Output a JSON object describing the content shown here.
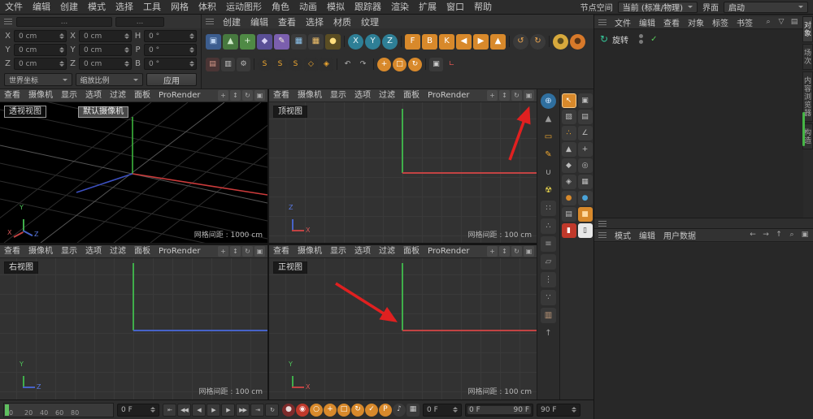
{
  "menubar": {
    "items": [
      "文件",
      "编辑",
      "创建",
      "模式",
      "选择",
      "工具",
      "网格",
      "体积",
      "运动图形",
      "角色",
      "动画",
      "模拟",
      "跟踪器",
      "渲染",
      "扩展",
      "窗口",
      "帮助"
    ],
    "node_space_label": "节点空间",
    "render_engine": "当前 (标准/物理)",
    "interface_label": "界面",
    "layout_value": "启动"
  },
  "coord_panel": {
    "tab1": "...",
    "tab2": "...",
    "rows": [
      {
        "a": "X",
        "av": "0 cm",
        "b": "X",
        "bv": "0 cm",
        "c": "H",
        "cv": "0 °"
      },
      {
        "a": "Y",
        "av": "0 cm",
        "b": "Y",
        "bv": "0 cm",
        "c": "P",
        "cv": "0 °"
      },
      {
        "a": "Z",
        "av": "0 cm",
        "b": "Z",
        "bv": "0 cm",
        "c": "B",
        "cv": "0 °"
      }
    ],
    "world_dropdown": "世界坐标",
    "scale_dropdown": "缩放比例",
    "apply_button": "应用"
  },
  "edit_menubar": [
    "创建",
    "编辑",
    "查看",
    "选择",
    "材质",
    "纹理"
  ],
  "toolbar_row1": [
    {
      "n": "primitive-cube-icon",
      "g": "▣",
      "c": "#bcd4f2",
      "b": "#3c5d8f"
    },
    {
      "n": "pyramid-icon",
      "g": "▲",
      "c": "#cfe9c8",
      "b": "#47793f"
    },
    {
      "n": "mograph-icon",
      "g": "+",
      "c": "#dff3da",
      "b": "#4f8a45"
    },
    {
      "n": "volume-icon",
      "g": "◆",
      "c": "#d9d2f5",
      "b": "#5a4f96"
    },
    {
      "n": "spline-pen-icon",
      "g": "✎",
      "c": "#f2ead8",
      "b": "#7b5fae"
    },
    {
      "n": "camera-icon",
      "g": "▦",
      "c": "#8ec6f0",
      "b": "#3a3a3a"
    },
    {
      "n": "render-settings-icon",
      "g": "▦",
      "c": "#f0c06a",
      "b": "#3a3a3a"
    },
    {
      "n": "light-icon",
      "g": "●",
      "c": "#ffdf7e",
      "b": "#5a4d23"
    },
    {
      "sep": 1
    },
    {
      "n": "lock-x-button",
      "g": "X",
      "c": "#eaf6f8",
      "b": "#2e7f96",
      "r": "50%"
    },
    {
      "n": "lock-y-button",
      "g": "Y",
      "c": "#eaf6f8",
      "b": "#2e7f96",
      "r": "50%"
    },
    {
      "n": "lock-z-button",
      "g": "Z",
      "c": "#eaf6f8",
      "b": "#2e7f96",
      "r": "50%"
    },
    {
      "sep": 1
    },
    {
      "n": "key-f-button",
      "g": "F",
      "c": "#ffffff",
      "b": "#d8892b"
    },
    {
      "n": "key-b-button",
      "g": "B",
      "c": "#ffffff",
      "b": "#d8892b"
    },
    {
      "n": "key-k-button",
      "g": "K",
      "c": "#ffffff",
      "b": "#d8892b"
    },
    {
      "n": "nav-left-button",
      "g": "◀",
      "c": "#ffffff",
      "b": "#d8892b"
    },
    {
      "n": "nav-right-button",
      "g": "▶",
      "c": "#ffffff",
      "b": "#d8892b"
    },
    {
      "n": "nav-up-button",
      "g": "▲",
      "c": "#ffffff",
      "b": "#d8892b"
    },
    {
      "sep": 1
    },
    {
      "n": "ik-circle-icon",
      "g": "↺",
      "c": "#f0a850",
      "b": "#3a3a3a",
      "r": "50%"
    },
    {
      "n": "dynamics-circle-icon",
      "g": "↻",
      "c": "#f0a850",
      "b": "#3a3a3a",
      "r": "50%"
    },
    {
      "sep": 1
    },
    {
      "n": "render-gold-icon",
      "g": "●",
      "c": "#5a4b1e",
      "b": "#d7a93c",
      "r": "50%"
    },
    {
      "n": "material-orange-icon",
      "g": "●",
      "c": "#5a3516",
      "b": "#d8792a",
      "r": "50%"
    }
  ],
  "toolbar_row2": [
    {
      "n": "paint-icon",
      "g": "▤",
      "c": "#d89a8a",
      "b": "#4a3535"
    },
    {
      "n": "uv-icon",
      "g": "▥",
      "c": "#c8c8c8",
      "b": "#3a3a3a"
    },
    {
      "n": "gear-icon",
      "g": "⚙",
      "c": "#bdbdbd",
      "b": "#3a3a3a"
    },
    {
      "sep": 1
    },
    {
      "n": "snap-1-icon",
      "g": "S",
      "c": "#f0a830",
      "b": "#2d2d2d",
      "r": "50%"
    },
    {
      "n": "snap-2-icon",
      "g": "S",
      "c": "#f0a830",
      "b": "#2d2d2d",
      "r": "50%"
    },
    {
      "n": "snap-3-icon",
      "g": "S",
      "c": "#f0a830",
      "b": "#2d2d2d",
      "r": "50%"
    },
    {
      "n": "quantize-icon",
      "g": "◇",
      "c": "#f0a830",
      "b": "#2d2d2d"
    },
    {
      "n": "workplane-icon",
      "g": "◈",
      "c": "#f0a830",
      "b": "#2d2d2d"
    },
    {
      "sep": 1
    },
    {
      "n": "undo-icon",
      "g": "↶",
      "c": "#b5b5b5",
      "b": "transparent"
    },
    {
      "n": "redo-icon",
      "g": "↷",
      "c": "#b5b5b5",
      "b": "transparent"
    },
    {
      "sep": 1
    },
    {
      "n": "move-tool-icon",
      "g": "+",
      "c": "#ffffff",
      "b": "#d8892b",
      "r": "50%"
    },
    {
      "n": "scale-tool-icon",
      "g": "□",
      "c": "#ffffff",
      "b": "#d8892b",
      "r": "50%"
    },
    {
      "n": "rotate-tool-icon",
      "g": "↻",
      "c": "#ffffff",
      "b": "#d8892b",
      "r": "50%"
    },
    {
      "sep": 1
    },
    {
      "n": "coord-system-icon",
      "g": "▣",
      "c": "#cccccc",
      "b": "#3a3a3a"
    },
    {
      "n": "world-axis-icon",
      "g": "∟",
      "c": "#d9534f",
      "b": "transparent"
    }
  ],
  "viewport_menu": [
    "查看",
    "摄像机",
    "显示",
    "选项",
    "过滤",
    "面板",
    "ProRender"
  ],
  "viewport_header_icons": [
    {
      "n": "pan-view-icon",
      "g": "+"
    },
    {
      "n": "zoom-view-icon",
      "g": "↕"
    },
    {
      "n": "rotate-view-icon",
      "g": "↻"
    },
    {
      "n": "toggle-view-icon",
      "g": "▣"
    }
  ],
  "viewports": {
    "vp1": {
      "title": "透视视图",
      "tooltip": "默认摄像机",
      "grid_label": "网格间距 : 1000 cm",
      "gizmo": [
        "Y",
        "Z",
        "X"
      ]
    },
    "vp2": {
      "title": "顶视图",
      "grid_label": "网格间距 : 100 cm",
      "gizmo": [
        "Z",
        "X"
      ]
    },
    "vp3": {
      "title": "右视图",
      "grid_label": "网格间距 : 100 cm",
      "gizmo": [
        "Y",
        "Z"
      ]
    },
    "vp4": {
      "title": "正视图",
      "grid_label": "网格间距 : 100 cm",
      "gizmo": [
        "Y",
        "X"
      ]
    }
  },
  "side_tools_a": [
    {
      "n": "globe-icon",
      "g": "⊕",
      "c": "#cfe6ff",
      "b": "#2f6f9f",
      "r": "50%"
    },
    {
      "n": "cone-icon",
      "g": "▲",
      "c": "#9a9a9a"
    },
    {
      "n": "ruler-icon",
      "g": "▭",
      "c": "#f0a830"
    },
    {
      "n": "pen-icon",
      "g": "✎",
      "c": "#f0a830"
    },
    {
      "n": "magnet-icon",
      "g": "∪",
      "c": "#b0b0b0"
    },
    {
      "n": "radioactive-icon",
      "g": "☢",
      "c": "#e8d44d"
    },
    {
      "n": "snap-grid-icon",
      "g": "∷",
      "c": "#a0a0a0",
      "b": "#383838"
    },
    {
      "n": "snap-vertex-icon",
      "g": "∴",
      "c": "#a0a0a0",
      "b": "#383838"
    },
    {
      "n": "snap-edge-icon",
      "g": "≡",
      "c": "#a0a0a0",
      "b": "#383838"
    },
    {
      "n": "snap-poly-icon",
      "g": "▱",
      "c": "#a0a0a0",
      "b": "#383838"
    },
    {
      "n": "snap-axis-icon",
      "g": "⋮",
      "c": "#a0a0a0",
      "b": "#383838"
    },
    {
      "n": "snap-guide-icon",
      "g": "∵",
      "c": "#a0a0a0",
      "b": "#383838"
    },
    {
      "n": "palette-icon",
      "g": "▥",
      "c": "#c09a7a",
      "b": "#383838"
    },
    {
      "n": "up-arrow-icon",
      "g": "↑",
      "c": "#a0a0a0"
    }
  ],
  "side_tools_b": [
    {
      "n": "live-selection-icon",
      "g": "↖",
      "c": "#ffffff",
      "b": "#d8892b",
      "bd": "1px solid #f5c98a"
    },
    {
      "n": "model-mode-icon",
      "g": "▣"
    },
    {
      "n": "texture-mode-icon",
      "g": "▨"
    },
    {
      "n": "workplane-mode-icon",
      "g": "▤"
    },
    {
      "n": "points-mode-icon",
      "g": "∴",
      "c": "#f0a830"
    },
    {
      "n": "edges-mode-icon",
      "g": "∠"
    },
    {
      "n": "polygons-mode-icon",
      "g": "▲"
    },
    {
      "n": "axis-mode-icon",
      "g": "+"
    },
    {
      "n": "normal-move-icon",
      "g": "◆"
    },
    {
      "n": "solo-icon",
      "g": "◎"
    },
    {
      "n": "tweak-icon",
      "g": "◈"
    },
    {
      "n": "viewport-filter-icon",
      "g": "▦"
    },
    {
      "n": "material-ball-icon",
      "g": "●",
      "c": "#d8892b"
    },
    {
      "n": "material-ball-blue-icon",
      "g": "●",
      "c": "#4aa3d8"
    },
    {
      "n": "layers-icon",
      "g": "▤"
    },
    {
      "n": "active-material-icon",
      "g": "■",
      "c": "#ffd9a0",
      "b": "#d8892b"
    },
    {
      "n": "red-channel-icon",
      "g": "▮",
      "c": "#ffffff",
      "b": "#c0392b"
    },
    {
      "n": "white-channel-icon",
      "g": "▯",
      "c": "#333333",
      "b": "#e8e8e8"
    }
  ],
  "object_manager": {
    "menus": [
      "文件",
      "编辑",
      "查看",
      "对象",
      "标签",
      "书签"
    ],
    "header_icons": [
      {
        "n": "search-icon",
        "g": "⌕"
      },
      {
        "n": "filter-icon",
        "g": "▽"
      },
      {
        "n": "list-view-icon",
        "g": "▤"
      }
    ],
    "object": {
      "icon": "↻",
      "name": "旋转",
      "check": "✓"
    },
    "side_tabs": [
      {
        "n": "tab-objects",
        "t": "对象",
        "b": "#3d3d3d",
        "c": "#e0e0e0"
      },
      {
        "n": "tab-takes",
        "t": "场次"
      },
      {
        "n": "tab-content-browser",
        "t": "内容浏览器"
      },
      {
        "n": "tab-structure",
        "t": "构造"
      }
    ]
  },
  "attribute_manager": {
    "menus": [
      "模式",
      "编辑",
      "用户数据"
    ],
    "header_icons": [
      {
        "n": "back-arrow-icon",
        "g": "←"
      },
      {
        "n": "forward-arrow-icon",
        "g": "→"
      },
      {
        "n": "up-arrow-icon",
        "g": "↑"
      },
      {
        "n": "search-icon",
        "g": "⌕"
      },
      {
        "n": "lock-icon",
        "g": "▣"
      }
    ]
  },
  "timeline": {
    "ticks": [
      "0",
      "20",
      "40",
      "60",
      "80"
    ],
    "current_frame": "0 F",
    "playback": [
      {
        "n": "goto-start-button",
        "g": "⇤"
      },
      {
        "n": "prev-key-button",
        "g": "◀◀"
      },
      {
        "n": "prev-frame-button",
        "g": "◀"
      },
      {
        "n": "play-button",
        "g": "▶"
      },
      {
        "n": "next-frame-button",
        "g": "▶"
      },
      {
        "n": "next-key-button",
        "g": "▶▶"
      },
      {
        "n": "goto-end-button",
        "g": "⇥"
      },
      {
        "n": "loop-button",
        "g": "↻"
      }
    ],
    "record": [
      {
        "n": "record-objects-icon",
        "g": "●",
        "c": "#e8dcdc",
        "b": "#7d2b2b",
        "r": "50%"
      },
      {
        "n": "autokey-icon",
        "g": "◉",
        "c": "#ffecec",
        "b": "#c0392b",
        "r": "50%"
      },
      {
        "n": "keyframe-selection-icon",
        "g": "○",
        "c": "#ffffff",
        "b": "#d8892b",
        "r": "50%"
      },
      {
        "n": "record-position-icon",
        "g": "+",
        "c": "#ffffff",
        "b": "#d8892b",
        "r": "50%"
      },
      {
        "n": "record-scale-icon",
        "g": "□",
        "c": "#ffffff",
        "b": "#d8892b",
        "r": "50%"
      },
      {
        "n": "record-rotation-icon",
        "g": "↻",
        "c": "#ffffff",
        "b": "#d8892b",
        "r": "50%"
      },
      {
        "n": "record-parameter-icon",
        "g": "✓",
        "c": "#ffffff",
        "b": "#d8892b",
        "r": "50%"
      },
      {
        "n": "record-pla-icon",
        "g": "P",
        "c": "#ffffff",
        "b": "#d8892b",
        "r": "50%"
      },
      {
        "n": "sound-icon",
        "g": "♪",
        "c": "#cccccc",
        "b": "#3a3a3a",
        "r": "50%"
      },
      {
        "n": "keyframe-grid-icon",
        "g": "▦",
        "c": "#cccccc",
        "b": "#3a3a3a"
      }
    ],
    "range_start_field": "0 F",
    "range_start": "0 F",
    "range_end": "90 F",
    "end_field": "90 F"
  },
  "annotation_color": "#e02020"
}
